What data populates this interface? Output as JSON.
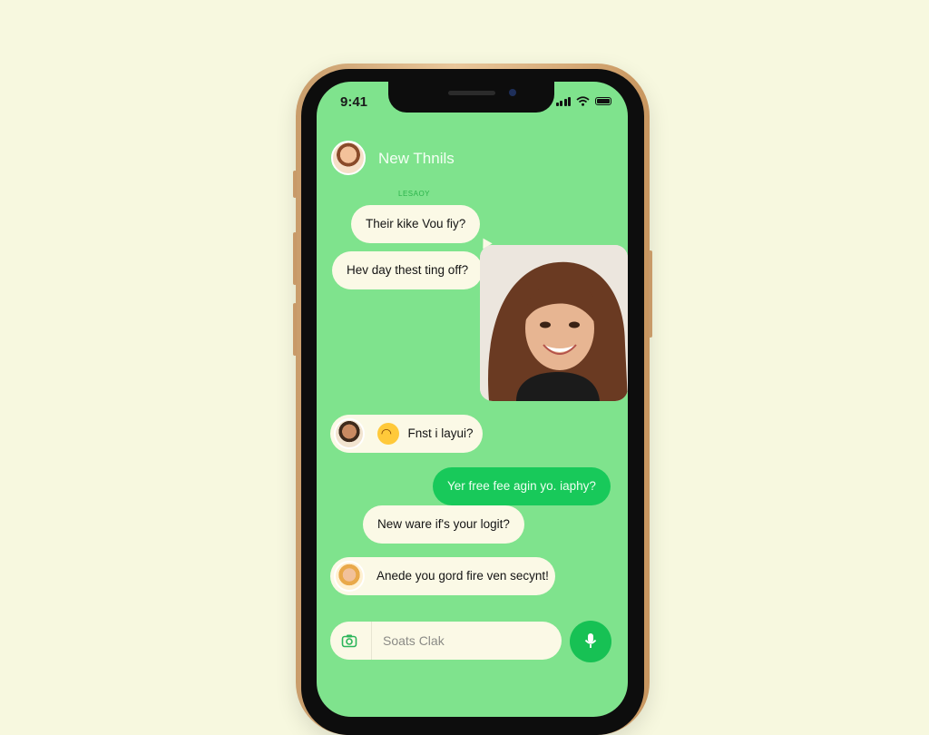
{
  "status_bar": {
    "time": "9:41"
  },
  "chat": {
    "contact_name": "New Thnils",
    "day_label": "LESAOY"
  },
  "messages": [
    {
      "text": "Their kike Vou fiy?"
    },
    {
      "text": "Hev day thest ting off?"
    },
    {
      "text": "Fnst i layui?"
    },
    {
      "text": "Yer free fee agin yo. iaphy?"
    },
    {
      "text": "New ware if's your logit?"
    },
    {
      "text": "Anede you gord fire ven secynt!"
    }
  ],
  "composer": {
    "placeholder": "Soats Clak"
  },
  "colors": {
    "background": "#f7f8df",
    "chat_background": "#7fe38d",
    "sent_bubble": "#18c95a",
    "received_bubble": "#fbf9e6",
    "accent": "#17c154"
  },
  "icons": [
    "signal-icon",
    "wifi-icon",
    "battery-icon",
    "camera-icon",
    "microphone-icon",
    "laughing-emoji-icon"
  ]
}
